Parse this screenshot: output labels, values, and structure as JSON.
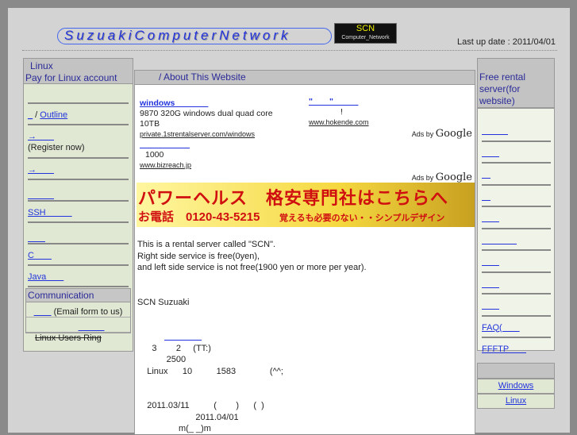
{
  "header": {
    "logo": "SuzuakiComputerNetwork",
    "badge_main": "SCN",
    "badge_sub": "Computer_Network",
    "last_update": "Last up date : 2011/04/01"
  },
  "left": {
    "title1": "Linux",
    "title2": "Pay for Linux account",
    "items": [
      {
        "link": "_",
        "sep": " / ",
        "link2": "Outline"
      },
      {
        "link": "→　　",
        "note": "(Register now)"
      },
      {
        "link": "→　　"
      },
      {
        "link": "　　　"
      },
      {
        "link": "SSH　　　"
      },
      {
        "link": "　　"
      },
      {
        "link": "C　　"
      },
      {
        "link": "Java　　"
      }
    ],
    "communication": {
      "title": "Communication",
      "email_link": "　　",
      "email_note": " (Email form to us)",
      "link2": "　　　"
    },
    "ring": "Linux Users Ring"
  },
  "main": {
    "title": "/ About This Website",
    "ads": [
      {
        "title": "windows　　　　",
        "line1": "9870  320G     windows dual quad core",
        "line2": "10TB",
        "url": "private.1strentalserver.com/windows"
      },
      {
        "title": "\"　　\"　　　",
        "line1": "!",
        "url": "www.hokende.com"
      },
      {
        "title": "　　　　　　",
        "line1": "1000",
        "url": "www.bizreach.jp"
      }
    ],
    "ads_by": "Ads by",
    "google": "Google",
    "banner": {
      "line1": "パワーヘルス　格安専門社はこちらへ",
      "phone": "お電話　0120-43-5215",
      "line3": "覚えるも必要のない・・シンプルデザイン"
    },
    "body": [
      "This is a rental server called \"SCN\".",
      "Right side service is free(0yen),",
      "and left side service is not free(1900 yen or more per year).",
      "",
      "",
      "SCN Suzuaki",
      "",
      "",
      "　　　　 ",
      "      3        2     (TT:)",
      "            2500",
      "    Linux      10          1583              (^^;",
      "",
      "",
      "    2011.03/11          (        )      (  )",
      "                        2011.04/01",
      "                 m(_ _)m"
    ]
  },
  "right": {
    "title": "Free rental server(for website)",
    "items": [
      "　　　",
      "　　",
      "　",
      "　",
      "　　",
      "　　　　",
      "　　",
      "　　",
      "　　",
      "FAQ(　　",
      "FFFTP　　"
    ],
    "links": [
      "Windows ",
      "Linux "
    ]
  }
}
